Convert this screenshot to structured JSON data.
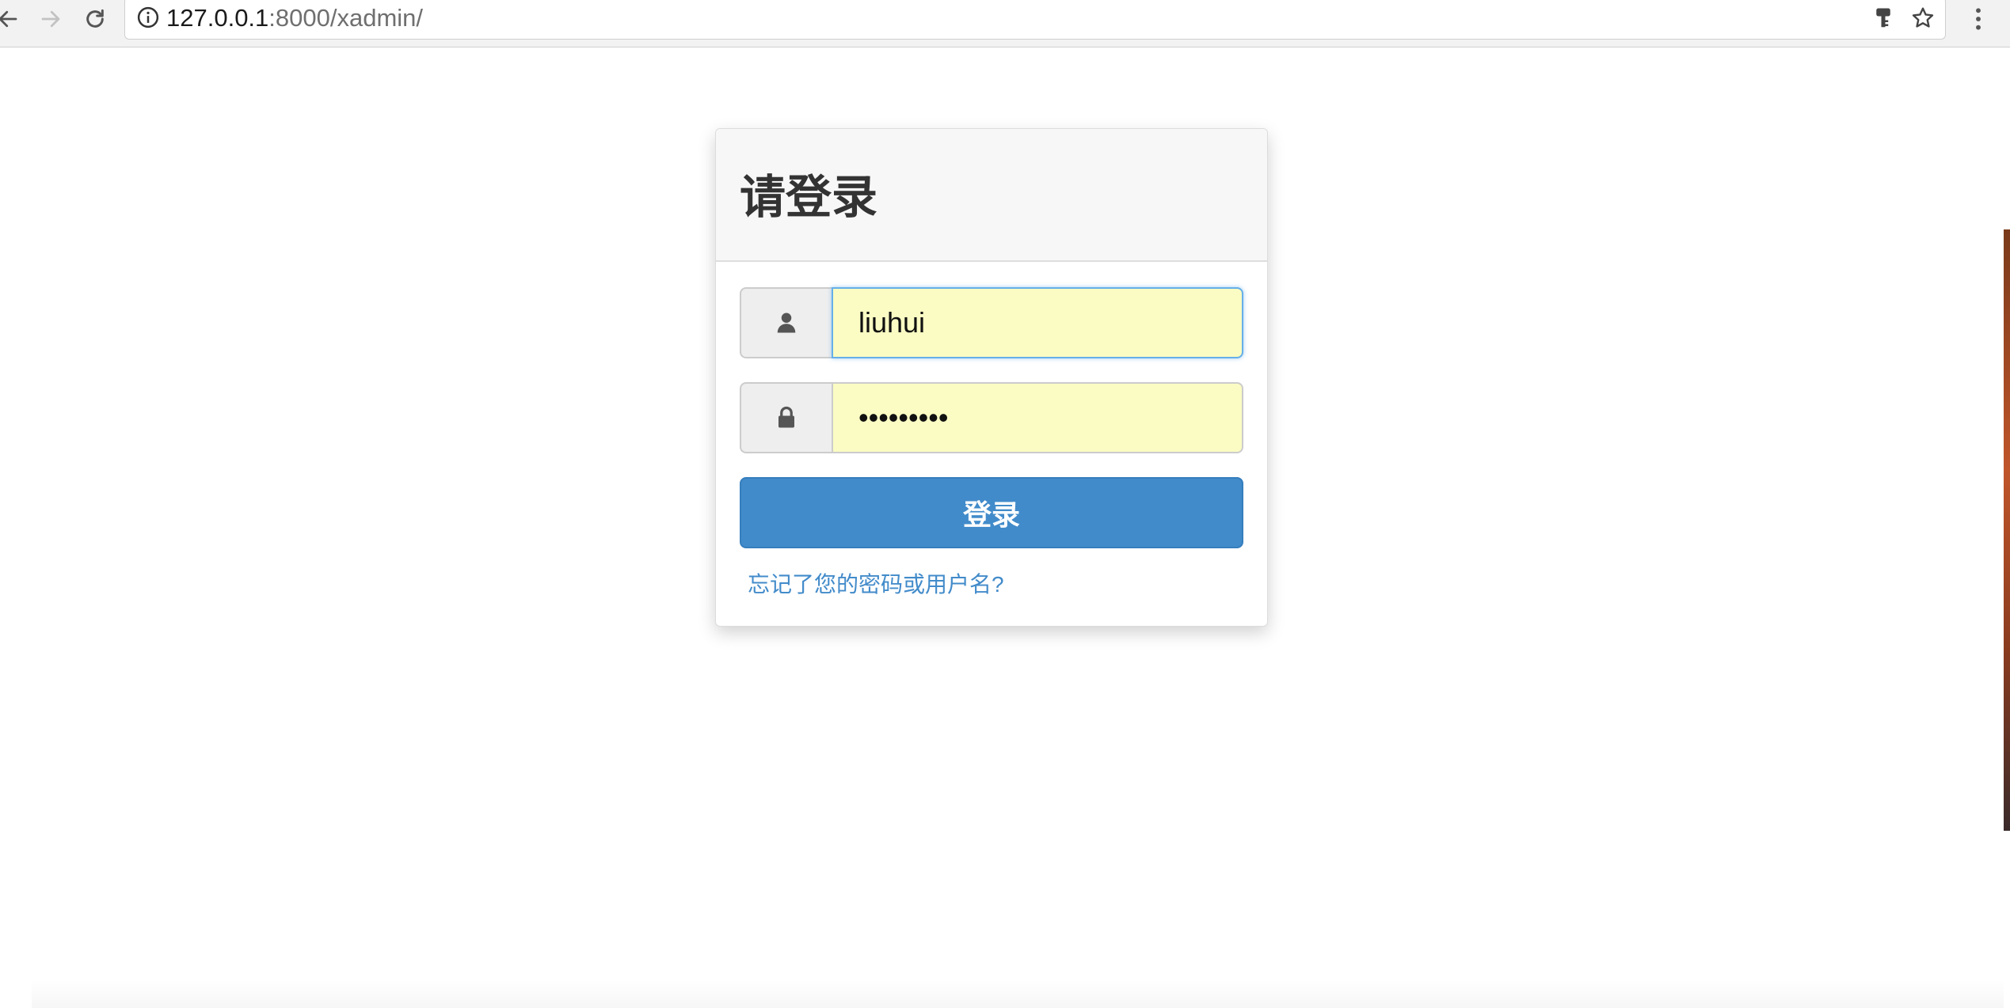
{
  "browser": {
    "url_host": "127.0.0.1",
    "url_rest": ":8000/xadmin/",
    "icons": {
      "back": "back-arrow-icon",
      "forward": "forward-arrow-icon",
      "reload": "reload-icon",
      "site_info": "info-icon",
      "key": "key-icon",
      "bookmark": "star-icon",
      "menu": "vertical-dots-icon"
    }
  },
  "login": {
    "title": "请登录",
    "username": {
      "value": "liuhui",
      "icon": "user-icon"
    },
    "password": {
      "value": "•••••••••",
      "icon": "lock-icon"
    },
    "submit_label": "登录",
    "forgot_label": "忘记了您的密码或用户名?"
  },
  "colors": {
    "primary": "#428bca",
    "autofill": "#fafcc3",
    "heading_bg": "#f7f7f7",
    "title_text": "#333333"
  }
}
